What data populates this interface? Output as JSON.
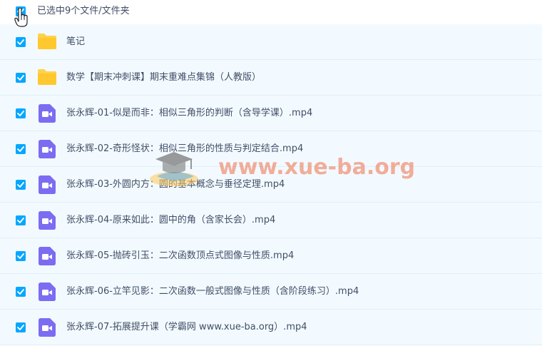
{
  "header": {
    "selection_text": "已选中9个文件/文件夹"
  },
  "files": [
    {
      "name": "笔记",
      "type": "folder"
    },
    {
      "name": "数学【期末冲刺课】期末重难点集锦（人教版）",
      "type": "folder"
    },
    {
      "name": "张永辉-01-似是而非：相似三角形的判断（含导学课）.mp4",
      "type": "video"
    },
    {
      "name": "张永辉-02-奇形怪状：相似三角形的性质与判定结合.mp4",
      "type": "video"
    },
    {
      "name": "张永辉-03-外圆内方：圆的基本概念与垂径定理.mp4",
      "type": "video"
    },
    {
      "name": "张永辉-04-原来如此：圆中的角（含家长会）.mp4",
      "type": "video"
    },
    {
      "name": "张永辉-05-抛砖引玉：二次函数顶点式图像与性质.mp4",
      "type": "video"
    },
    {
      "name": "张永辉-06-立竿见影：二次函数一般式图像与性质（含阶段练习）.mp4",
      "type": "video"
    },
    {
      "name": "张永辉-07-拓展提升课（学霸网 www.xue-ba.org）.mp4",
      "type": "video"
    }
  ],
  "watermark": {
    "text": "www.xue-ba.org"
  },
  "colors": {
    "checkbox": "#06a7ff",
    "folder": "#ffd24d",
    "video": "#7c6cf2",
    "row_bg": "#f2faff",
    "text": "#424e67"
  },
  "icons": {
    "folder": "folder-icon",
    "video": "video-file-icon",
    "checkbox": "checkbox-checked-icon",
    "cursor": "hand-pointer-icon"
  }
}
